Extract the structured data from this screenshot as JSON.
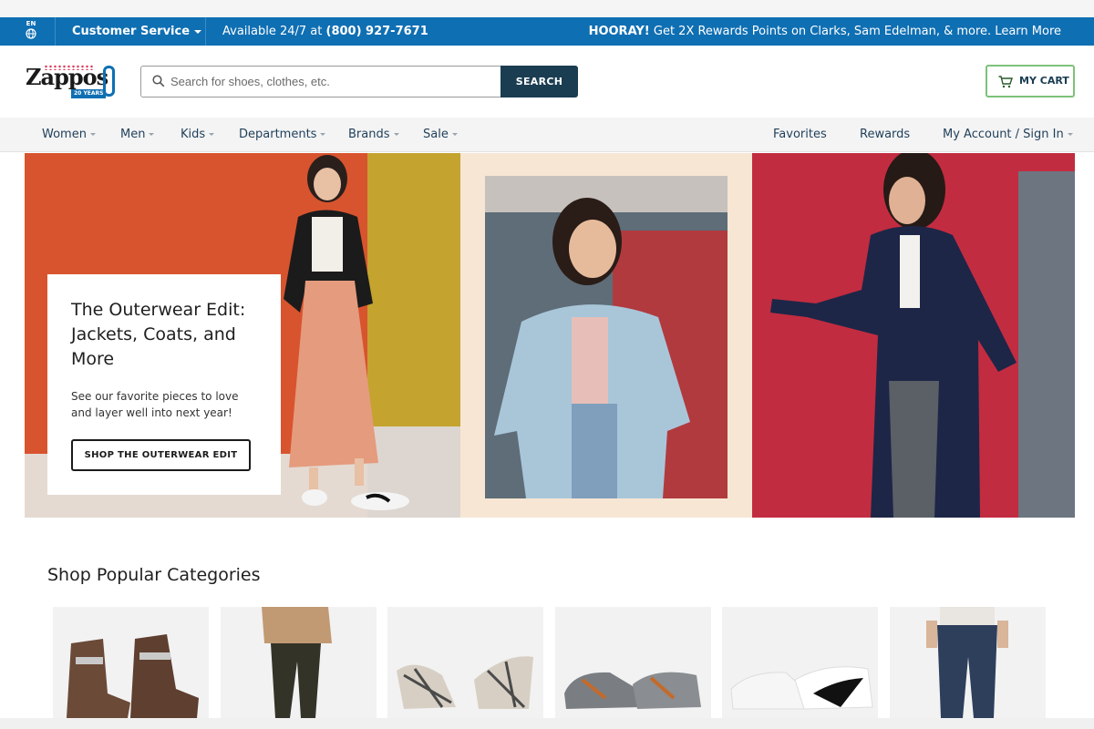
{
  "utility_bar": {
    "lang": "EN",
    "customer_service": "Customer Service",
    "available_prefix": "Available 24/7 at ",
    "phone": "(800) 927-7671",
    "promo_bold": "HOORAY!",
    "promo_text": " Get 2X Rewards Points on Clarks, Sam Edelman, & more. Learn More"
  },
  "header": {
    "logo_text": "Zappos",
    "logo_badge": "20 YEARS",
    "search_placeholder": "Search for shoes, clothes, etc.",
    "search_button": "SEARCH",
    "cart_label": "MY CART"
  },
  "nav": {
    "left": [
      "Women",
      "Men",
      "Kids",
      "Departments",
      "Brands",
      "Sale"
    ],
    "right": [
      "Favorites",
      "Rewards",
      "My Account / Sign In"
    ]
  },
  "hero": {
    "title": "The Outerwear Edit: Jackets, Coats, and More",
    "body": "See our favorite pieces to love and layer well into next year!",
    "cta": "SHOP THE OUTERWEAR EDIT"
  },
  "categories": {
    "title": "Shop Popular Categories",
    "tiles": [
      "boots",
      "sweater and leggings",
      "plaid pumps",
      "running sneakers",
      "white sneakers",
      "jeans"
    ]
  },
  "colors": {
    "utility_bar": "#0f6fb3",
    "search_button": "#1a3d52",
    "cart_border": "#7dc27a"
  }
}
